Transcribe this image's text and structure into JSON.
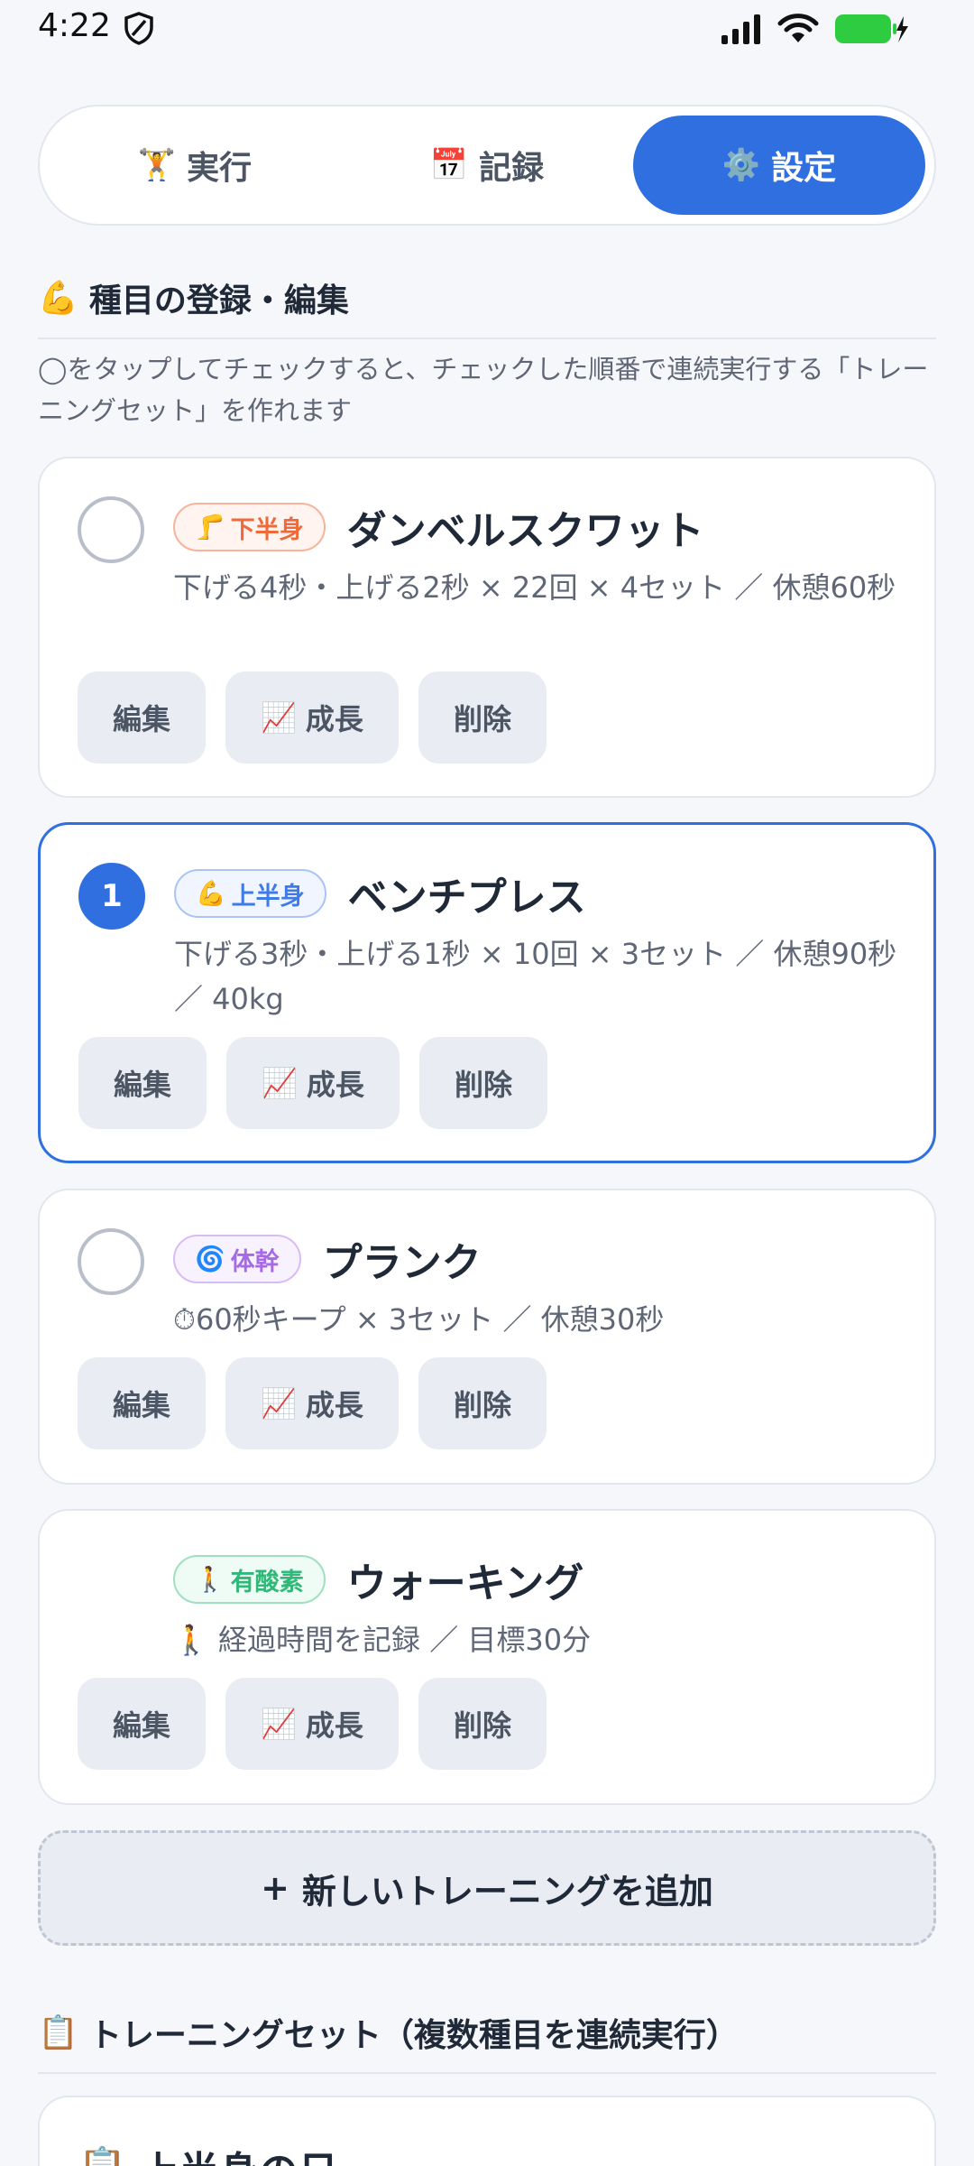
{
  "status_bar": {
    "time": "4:22"
  },
  "tabs": [
    {
      "icon": "🏋️",
      "label": "実行",
      "active": false
    },
    {
      "icon": "📅",
      "label": "記録",
      "active": false
    },
    {
      "icon": "⚙️",
      "label": "設定",
      "active": true
    }
  ],
  "section_exercises": {
    "icon": "💪",
    "title": "種目の登録・編集",
    "hint": "◯をタップしてチェックすると、チェックした順番で連続実行する「トレーニングセット」を作れます"
  },
  "exercises": [
    {
      "check": "",
      "badge_icon": "🦵",
      "badge": "下半身",
      "name": "ダンベルスクワット",
      "desc": "下げる4秒・上げる2秒 × 22回 × 4セット ／ 休憩60秒"
    },
    {
      "check": "1",
      "badge_icon": "💪",
      "badge": "上半身",
      "name": "ベンチプレス",
      "desc": "下げる3秒・上げる1秒 × 10回 × 3セット ／ 休憩90秒 ／ 40kg"
    },
    {
      "check": "",
      "badge_icon": "🌀",
      "badge": "体幹",
      "name": "プランク",
      "desc": "⏱60秒キープ × 3セット ／ 休憩30秒"
    },
    {
      "check": "",
      "badge_icon": "🚶",
      "badge": "有酸素",
      "name": "ウォーキング",
      "desc": "🚶 経過時間を記録 ／ 目標30分"
    }
  ],
  "actions": {
    "edit": "編集",
    "growth_icon": "📈",
    "growth": "成長",
    "delete": "削除"
  },
  "add_button": {
    "icon": "+",
    "label": "新しいトレーニングを追加"
  },
  "section_sets": {
    "icon": "📋",
    "title": "トレーニングセット（複数種目を連続実行）"
  },
  "sets": [
    {
      "icon": "📋",
      "name": "上半身の日"
    }
  ],
  "colors": {
    "accent": "#2f6fe0",
    "lower": "#ef6a3a",
    "upper": "#3e7be6",
    "core": "#a66be4",
    "cardio": "#2fb877"
  }
}
